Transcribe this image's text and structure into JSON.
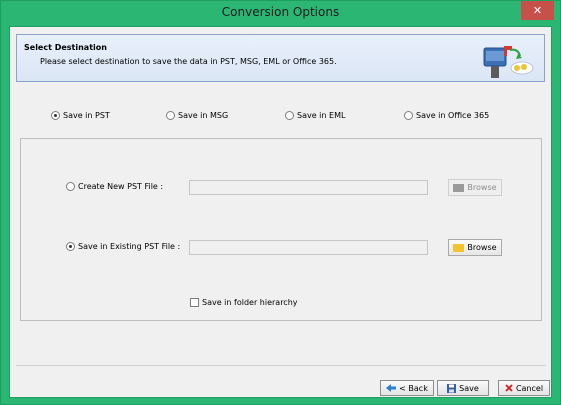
{
  "window": {
    "title": "Conversion Options",
    "close_glyph": "✕"
  },
  "header": {
    "title": "Select Destination",
    "description": "Please select destination to save the data in PST, MSG, EML or Office 365.",
    "icon": "mailbox-cloud-icon"
  },
  "destinations": [
    {
      "label": "Save in PST",
      "checked": true
    },
    {
      "label": "Save in MSG",
      "checked": false
    },
    {
      "label": "Save in EML",
      "checked": false
    },
    {
      "label": "Save in Office 365",
      "checked": false
    }
  ],
  "pst_options": {
    "create_new": {
      "label": "Create New PST File :",
      "checked": false,
      "value": "",
      "browse_label": "Browse",
      "browse_enabled": false
    },
    "existing": {
      "label": "Save in Existing PST File :",
      "checked": true,
      "value": "",
      "browse_label": "Browse",
      "browse_enabled": true
    },
    "folder_hierarchy": {
      "label": "Save in folder hierarchy",
      "checked": false
    }
  },
  "footer": {
    "back_label": "< Back",
    "back_icon": "back-arrow-icon",
    "save_label": "Save",
    "save_icon": "floppy-disk-icon",
    "cancel_label": "Cancel",
    "cancel_icon": "cancel-x-icon"
  },
  "colors": {
    "title_bar": "#2bb673",
    "close_button": "#c7504a",
    "header_border": "#8aa3c8",
    "folder_yellow": "#f2c230"
  }
}
